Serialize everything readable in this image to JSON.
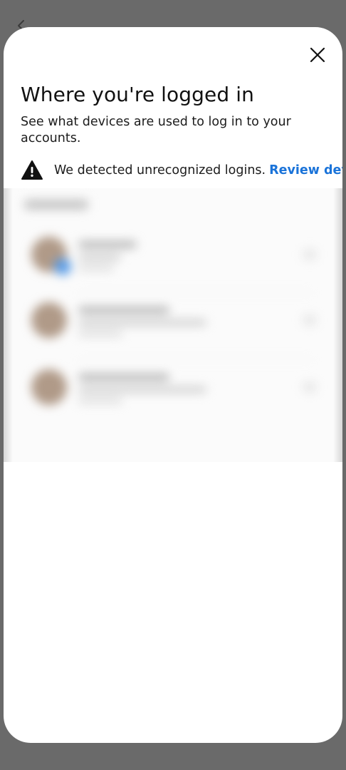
{
  "sheet": {
    "title": "Where you're logged in",
    "subtitle": "See what devices are used to log in to your accounts.",
    "alert": {
      "text": "We detected unrecognized logins.",
      "link_label": "Review devices"
    }
  },
  "colors": {
    "backdrop": "#6a6a6a",
    "sheet": "#ffffff",
    "link": "#1a73d9",
    "text": "#1c1c1c"
  },
  "icons": {
    "back": "chevron-left-icon",
    "close": "close-icon",
    "alert": "warning-triangle-icon"
  },
  "accounts_section": {
    "state": "blurred",
    "rows": 3
  }
}
